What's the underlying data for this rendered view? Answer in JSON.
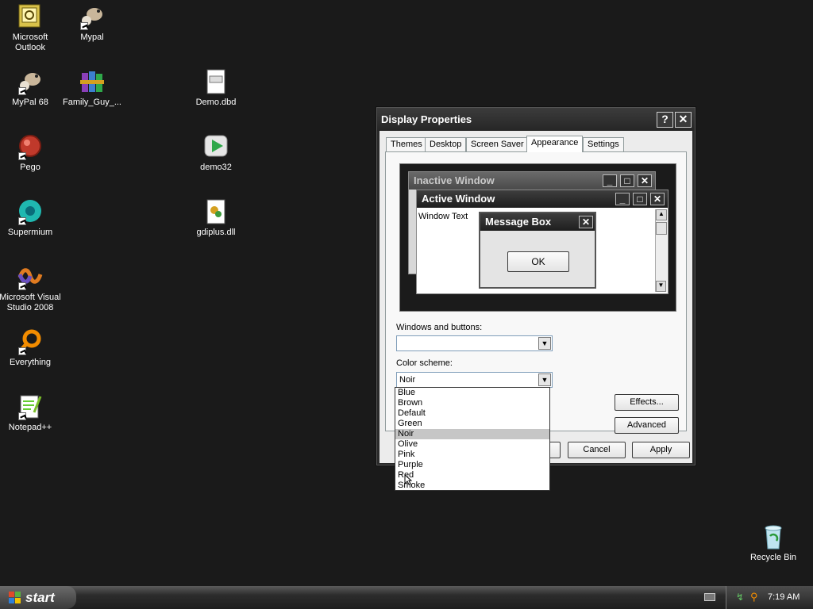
{
  "desktop": {
    "icons": [
      {
        "label": "Microsoft Outlook",
        "icon": "outlook-icon"
      },
      {
        "label": "Mypal",
        "icon": "mypal-icon"
      },
      {
        "label": "MyPal 68",
        "icon": "mypal-icon"
      },
      {
        "label": "Family_Guy_...",
        "icon": "winrar-archive-icon"
      },
      {
        "label": "Demo.dbd",
        "icon": "document-icon"
      },
      {
        "label": "Pego",
        "icon": "pego-icon"
      },
      {
        "label": "demo32",
        "icon": "play-icon"
      },
      {
        "label": "Supermium",
        "icon": "supermium-icon"
      },
      {
        "label": "gdiplus.dll",
        "icon": "dll-icon"
      },
      {
        "label": "Microsoft Visual Studio 2008",
        "icon": "visual-studio-icon"
      },
      {
        "label": "Everything",
        "icon": "everything-search-icon"
      },
      {
        "label": "Notepad++",
        "icon": "notepad-plus-plus-icon"
      },
      {
        "label": "Recycle Bin",
        "icon": "recycle-bin-icon"
      }
    ]
  },
  "dialog": {
    "title": "Display Properties",
    "help_label": "?",
    "close_label": "✕",
    "tabs": [
      {
        "label": "Themes"
      },
      {
        "label": "Desktop"
      },
      {
        "label": "Screen Saver"
      },
      {
        "label": "Appearance"
      },
      {
        "label": "Settings"
      }
    ],
    "preview": {
      "inactive_title": "Inactive Window",
      "active_title": "Active Window",
      "window_text": "Window Text",
      "message_title": "Message Box",
      "ok_label": "OK"
    },
    "windows_buttons_label": "Windows and buttons:",
    "windows_buttons_value": "",
    "color_scheme_label": "Color scheme:",
    "color_scheme_value": "Noir",
    "color_scheme_options": [
      "Blue",
      "Brown",
      "Default",
      "Green",
      "Noir",
      "Olive",
      "Pink",
      "Purple",
      "Red",
      "Smoke"
    ],
    "effects_label": "Effects...",
    "advanced_label": "Advanced",
    "cancel_label": "Cancel",
    "apply_label": "Apply"
  },
  "taskbar": {
    "start_label": "start",
    "time": "7:19 AM"
  }
}
